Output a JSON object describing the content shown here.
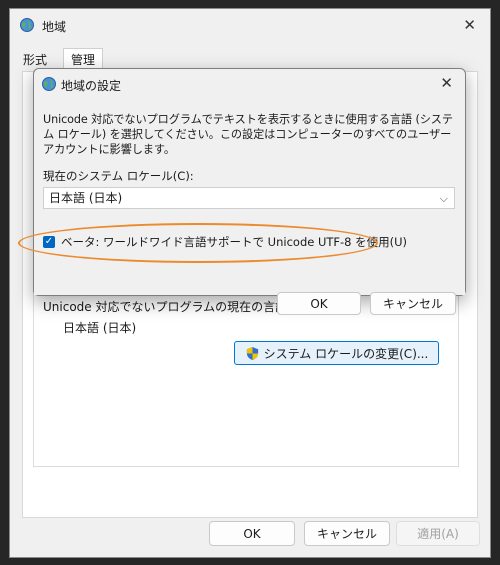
{
  "main_window": {
    "title": "地域",
    "tabs": [
      {
        "label": "形式"
      },
      {
        "label": "管理"
      }
    ],
    "unicode_section": {
      "label": "Unicode 対応でないプログラムの現在の言語:",
      "current_language": "日本語 (日本)",
      "change_button": "システム ロケールの変更(C)..."
    },
    "buttons": {
      "ok": "OK",
      "cancel": "キャンセル",
      "apply": "適用(A)"
    }
  },
  "dialog": {
    "title": "地域の設定",
    "description": "Unicode 対応でないプログラムでテキストを表示するときに使用する言語 (システム ロケール) を選択してください。この設定はコンピューターのすべてのユーザー アカウントに影響します。",
    "locale_label": "現在のシステム ロケール(C):",
    "locale_value": "日本語 (日本)",
    "utf8_checkbox_label": "ベータ: ワールドワイド言語サポートで Unicode UTF-8 を使用(U)",
    "utf8_checked": true,
    "buttons": {
      "ok": "OK",
      "cancel": "キャンセル"
    }
  },
  "colors": {
    "accent": "#0067c0",
    "highlight": "#ec8a2e"
  }
}
